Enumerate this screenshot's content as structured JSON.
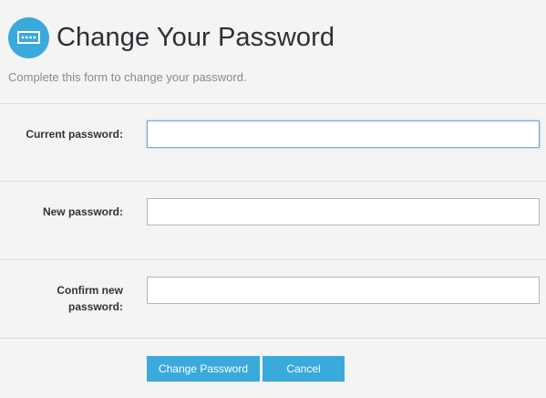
{
  "header": {
    "icon": "password-icon",
    "title": "Change Your Password",
    "subtitle": "Complete this form to change your password."
  },
  "form": {
    "fields": [
      {
        "label": "Current password:",
        "value": "",
        "type": "password",
        "focused": true
      },
      {
        "label": "New password:",
        "value": "",
        "type": "password",
        "focused": false
      },
      {
        "label": "Confirm new password:",
        "value": "",
        "type": "password",
        "focused": false
      }
    ]
  },
  "actions": {
    "submit_label": "Change Password",
    "cancel_label": "Cancel"
  },
  "colors": {
    "accent": "#3aa9dc",
    "background": "#f4f4f4",
    "divider": "#dcdcdc"
  }
}
